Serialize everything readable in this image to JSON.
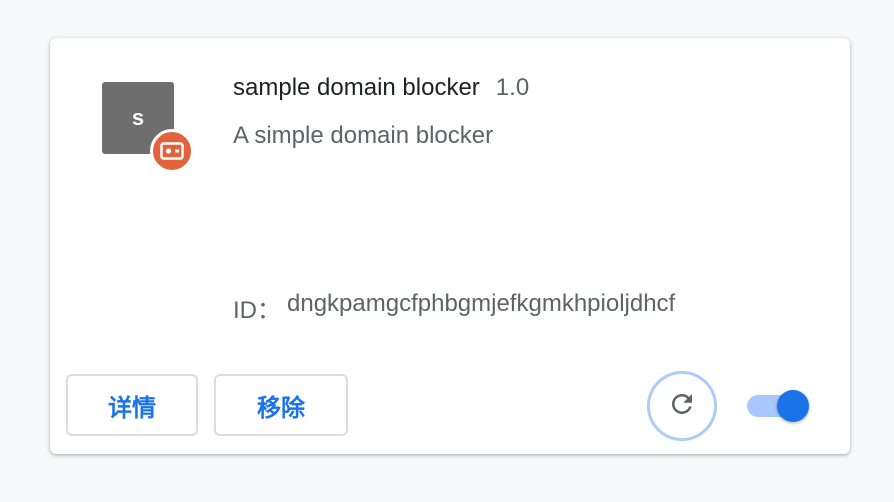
{
  "extension": {
    "icon_letter": "s",
    "name": "sample domain blocker",
    "version": "1.0",
    "description": "A simple domain blocker",
    "id_label": "ID：",
    "id_value": "dngkpamgcfphbgmjefkgmkhpioljdhcf",
    "enabled": true
  },
  "actions": {
    "details_label": "详情",
    "remove_label": "移除"
  },
  "icons": {
    "unpacked_badge": "unpacked-extension-icon",
    "reload": "reload-icon"
  },
  "colors": {
    "accent": "#1a73e8",
    "badge": "#e2623b",
    "icon_bg": "#6e6e6e",
    "toggle_track": "#a8c7fa"
  }
}
